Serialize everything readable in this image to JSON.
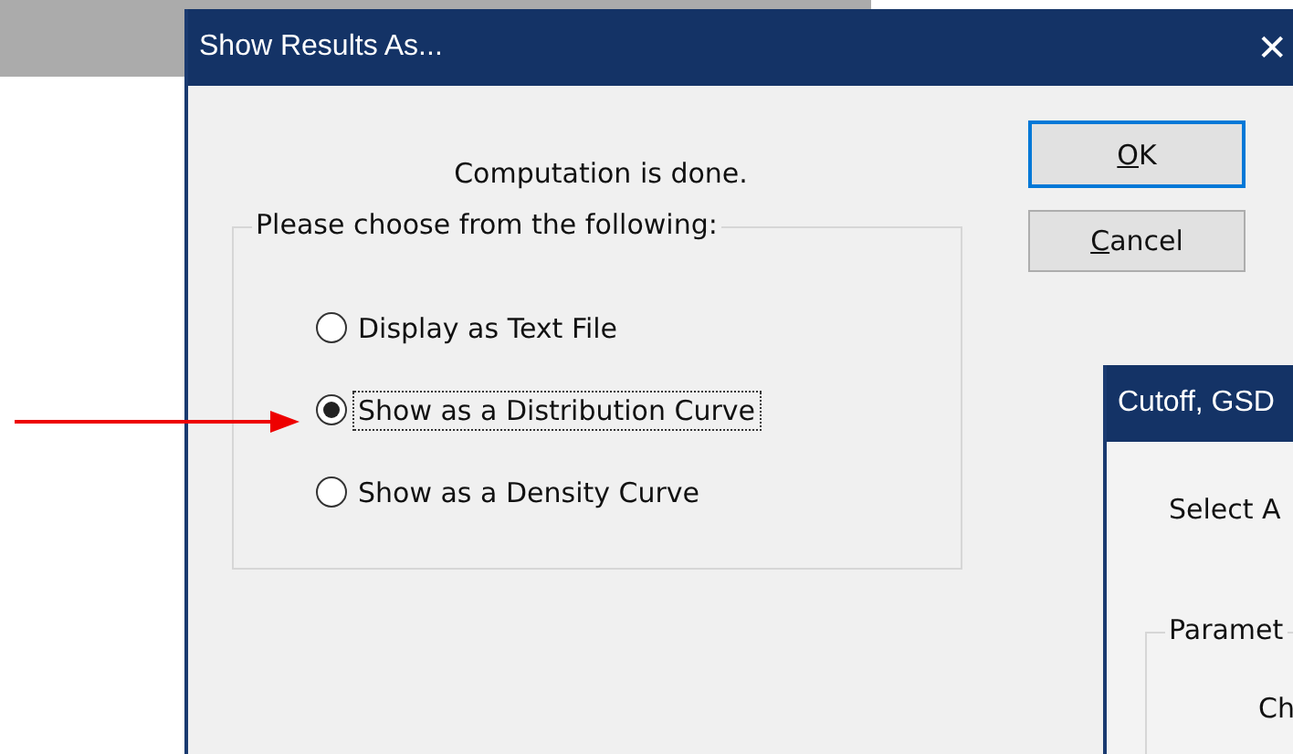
{
  "background_window": {
    "kind": "bar"
  },
  "dialog": {
    "title": "Show Results As...",
    "close": "✕",
    "message": "Computation is done.",
    "group_label": "Please choose from the following:",
    "options": [
      {
        "label": "Display as Text File",
        "selected": false
      },
      {
        "label": "Show as a Distribution Curve",
        "selected": true
      },
      {
        "label": "Show as a Density Curve",
        "selected": false
      }
    ],
    "buttons": [
      {
        "mnemonic": "O",
        "label_rest": "K",
        "default": true
      },
      {
        "mnemonic": "C",
        "label_rest": "ancel",
        "default": false
      }
    ]
  },
  "second_dialog": {
    "title": "Cutoff, GSD",
    "prompt": "Select A",
    "group_label": "Paramet",
    "field_label": "Ch"
  }
}
